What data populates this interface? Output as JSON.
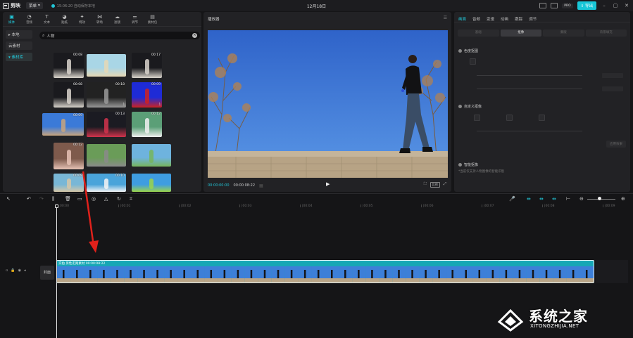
{
  "topbar": {
    "app_name": "剪映",
    "menu_label": "菜单",
    "autosave": "15:06:20 自动保存本地",
    "title": "12月18日",
    "pro_badge": "PRO",
    "export_label": "导出"
  },
  "media_tabs": [
    {
      "label": "媒体",
      "icon": "media-icon",
      "glyph": "▣"
    },
    {
      "label": "音频",
      "icon": "audio-icon",
      "glyph": "◔"
    },
    {
      "label": "文本",
      "icon": "text-icon",
      "glyph": "T"
    },
    {
      "label": "贴纸",
      "icon": "sticker-icon",
      "glyph": "◕"
    },
    {
      "label": "特效",
      "icon": "effects-icon",
      "glyph": "✦"
    },
    {
      "label": "转场",
      "icon": "transition-icon",
      "glyph": "⋈"
    },
    {
      "label": "滤镜",
      "icon": "filter-icon",
      "glyph": "☁"
    },
    {
      "label": "调节",
      "icon": "adjust-icon",
      "glyph": "⚌"
    },
    {
      "label": "素材包",
      "icon": "package-icon",
      "glyph": "▤"
    }
  ],
  "media_side": [
    {
      "label": "本地",
      "prefix": "▸ "
    },
    {
      "label": "云素材",
      "prefix": ""
    },
    {
      "label": "素材库",
      "prefix": "▾ "
    }
  ],
  "search": {
    "value": "人物"
  },
  "thumbnails": [
    {
      "duration": "00:08",
      "download": false,
      "scene": "portrait-dark"
    },
    {
      "duration": "",
      "download": false,
      "scene": "beach"
    },
    {
      "duration": "00:17",
      "download": false,
      "scene": "portrait-dark"
    },
    {
      "duration": "00:08",
      "download": false,
      "scene": "portrait-dark"
    },
    {
      "duration": "00:18",
      "download": true,
      "scene": "portrait-bw"
    },
    {
      "duration": "00:09",
      "download": true,
      "scene": "portrait-blue"
    },
    {
      "duration": "00:09",
      "download": false,
      "scene": "sky-walk"
    },
    {
      "duration": "00:13",
      "download": false,
      "scene": "portrait-red"
    },
    {
      "duration": "00:12",
      "download": false,
      "scene": "portrait-field"
    },
    {
      "duration": "00:12",
      "download": false,
      "scene": "portrait-face"
    },
    {
      "duration": "",
      "download": false,
      "scene": "road"
    },
    {
      "duration": "",
      "download": false,
      "scene": "meadow"
    },
    {
      "duration": "00:09",
      "download": false,
      "scene": "portrait-sea"
    },
    {
      "duration": "00:10",
      "download": false,
      "scene": "lake"
    },
    {
      "duration": "",
      "download": false,
      "scene": "sunrise"
    }
  ],
  "player": {
    "title": "播放器",
    "timecode_current": "00:00:00:00",
    "timecode_duration": "00:00:08:22"
  },
  "inspector": {
    "tabs": [
      "画面",
      "音频",
      "变速",
      "动画",
      "跟踪",
      "调节"
    ],
    "active_tab": 0,
    "subtabs": [
      "基础",
      "抠像",
      "蒙版",
      "背景填充"
    ],
    "active_subtab": 1,
    "chroma_key": "色度抠图",
    "custom_matting": "自定义抠像",
    "reset_label": "应用效果",
    "smart_matting": "智能抠像",
    "hint": "*当前仅支持人物图像的智能识别"
  },
  "ruler": {
    "labels": [
      "00:00",
      "|00:01",
      "|00:02",
      "|00:03",
      "|00:04",
      "|00:05",
      "|00:06",
      "|00:07",
      "|00:08",
      "|00:09"
    ]
  },
  "timeline": {
    "cover_label": "封面",
    "clip_label": "实拍 男性走路素材   00:00:08:22",
    "track_icons": [
      "lock-icon",
      "eye-icon",
      "mute-icon"
    ]
  },
  "watermark": {
    "text": "系统之家",
    "url": "XITONGZHIJIA.NET"
  },
  "colors": {
    "accent": "#22c5d6",
    "clip": "#16a7b5",
    "annotation_arrow": "#e0211b"
  }
}
